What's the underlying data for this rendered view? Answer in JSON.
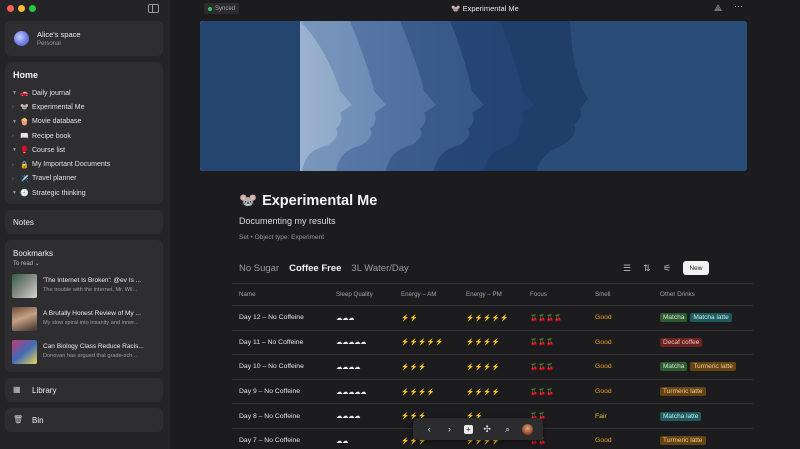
{
  "window": {
    "title": "Experimental Me",
    "title_icon": "🐭",
    "sync_status": "Synced"
  },
  "space": {
    "name": "Alice's space",
    "type": "Personal"
  },
  "home": {
    "title": "Home",
    "items": [
      {
        "label": "Daily journal",
        "icon": "🚗",
        "expanded": true
      },
      {
        "label": "Experimental Me",
        "icon": "🐭",
        "expanded": false
      },
      {
        "label": "Movie database",
        "icon": "🍿",
        "expanded": true
      },
      {
        "label": "Recipe book",
        "icon": "📖",
        "expanded": false
      },
      {
        "label": "Course list",
        "icon": "🥊",
        "expanded": true
      },
      {
        "label": "My Important Documents",
        "icon": "🔒",
        "expanded": false
      },
      {
        "label": "Travel planner",
        "icon": "✈️",
        "expanded": false
      },
      {
        "label": "Strategic thinking",
        "icon": "🕘",
        "expanded": true
      }
    ]
  },
  "notes": {
    "title": "Notes"
  },
  "bookmarks": {
    "title": "Bookmarks",
    "filter": "To read",
    "items": [
      {
        "title": "'The Internet Is Broken': @ev Is ...",
        "desc": "The trouble with the internet, Mr. Wil..."
      },
      {
        "title": "A Brutally Honest Review of My ...",
        "desc": "My slow spiral into insanity and inner..."
      },
      {
        "title": "Can Biology Class Reduce Racis...",
        "desc": "Donovan has argued that grade-sch..."
      }
    ]
  },
  "library": {
    "label": "Library"
  },
  "bin": {
    "label": "Bin"
  },
  "doc": {
    "title": "Experimental Me",
    "icon": "🐭",
    "subtitle": "Documenting my results",
    "meta": "Set  •  Object type: Experiment"
  },
  "tabs": [
    "No Sugar",
    "Coffee Free",
    "3L Water/Day"
  ],
  "active_tab": 1,
  "new_button": "New",
  "table": {
    "columns": [
      "Name",
      "Sleep Quality",
      "Energy – AM",
      "Energy – PM",
      "Focus",
      "Smell",
      "Other Drinks"
    ],
    "rows": [
      {
        "name": "Day 12 – No Coffeine",
        "sleep": "☁☁☁",
        "am": "⚡⚡",
        "pm": "⚡⚡⚡⚡⚡",
        "focus": "🍒🍒🍒🍒",
        "smell": "Good",
        "drinks": [
          {
            "label": "Matcha",
            "color": "green"
          },
          {
            "label": "Matcha latte",
            "color": "teal"
          }
        ]
      },
      {
        "name": "Day 11 – No Coffeine",
        "sleep": "☁☁☁☁☁",
        "am": "⚡⚡⚡⚡⚡",
        "pm": "⚡⚡⚡⚡",
        "focus": "🍒🍒🍒",
        "smell": "Good",
        "drinks": [
          {
            "label": "Decaf coffee",
            "color": "red"
          }
        ]
      },
      {
        "name": "Day 10 – No Coffeine",
        "sleep": "☁☁☁☁",
        "am": "⚡⚡⚡",
        "pm": "⚡⚡⚡⚡",
        "focus": "🍒🍒🍒",
        "smell": "Good",
        "drinks": [
          {
            "label": "Matcha",
            "color": "green"
          },
          {
            "label": "Turmeric latte",
            "color": "orange"
          }
        ]
      },
      {
        "name": "Day 9 – No Coffeine",
        "sleep": "☁☁☁☁☁",
        "am": "⚡⚡⚡⚡",
        "pm": "⚡⚡⚡⚡",
        "focus": "🍒🍒🍒",
        "smell": "Good",
        "drinks": [
          {
            "label": "Turmeric latte",
            "color": "orange"
          }
        ]
      },
      {
        "name": "Day 8 – No Coffeine",
        "sleep": "☁☁☁☁",
        "am": "⚡⚡⚡",
        "pm": "⚡⚡",
        "focus": "🍒🍒",
        "smell": "Fair",
        "drinks": [
          {
            "label": "Matcha latte",
            "color": "teal"
          }
        ]
      },
      {
        "name": "Day 7 – No Coffeine",
        "sleep": "☁☁",
        "am": "⚡⚡⚡",
        "pm": "⚡⚡⚡⚡",
        "focus": "🍒🍒",
        "smell": "Good",
        "drinks": [
          {
            "label": "Turmeric latte",
            "color": "orange"
          }
        ]
      }
    ]
  },
  "colors": {
    "accent_green": "#34c759",
    "cover_blue": "#2a4c78"
  },
  "floating_toolbar": {
    "icons": [
      "back-icon",
      "forward-icon",
      "plus-icon",
      "graph-icon",
      "search-icon",
      "avatar"
    ]
  }
}
